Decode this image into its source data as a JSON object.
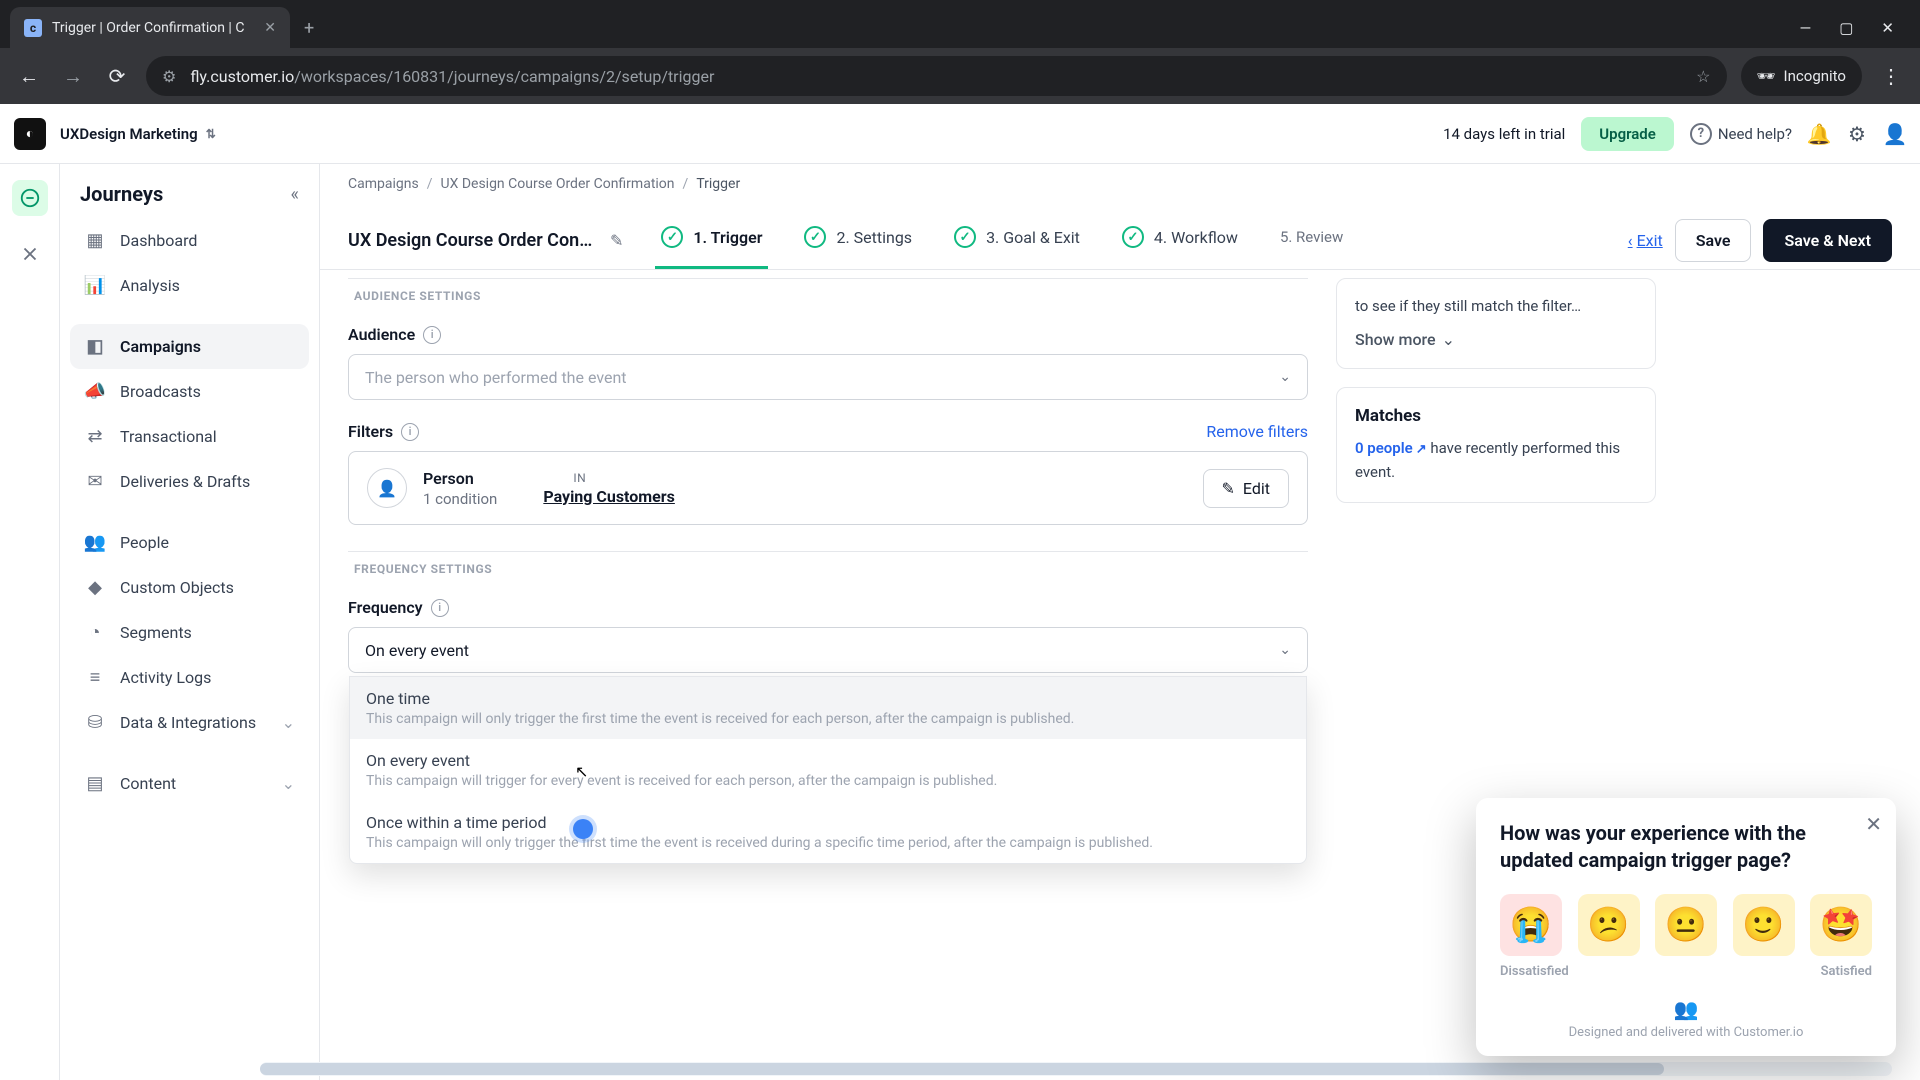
{
  "browser": {
    "tab_title": "Trigger | Order Confirmation | C",
    "url_host": "fly.customer.io",
    "url_path": "/workspaces/160831/journeys/campaigns/2/setup/trigger",
    "incognito": "Incognito"
  },
  "topbar": {
    "workspace": "UXDesign Marketing",
    "trial": "14 days left in trial",
    "upgrade": "Upgrade",
    "help": "Need help?"
  },
  "sidebar": {
    "title": "Journeys",
    "items": [
      {
        "label": "Dashboard"
      },
      {
        "label": "Analysis"
      },
      {
        "label": "Campaigns"
      },
      {
        "label": "Broadcasts"
      },
      {
        "label": "Transactional"
      },
      {
        "label": "Deliveries & Drafts"
      },
      {
        "label": "People"
      },
      {
        "label": "Custom Objects"
      },
      {
        "label": "Segments"
      },
      {
        "label": "Activity Logs"
      },
      {
        "label": "Data & Integrations"
      },
      {
        "label": "Content"
      }
    ]
  },
  "crumbs": {
    "a": "Campaigns",
    "b": "UX Design Course Order Confirmation",
    "c": "Trigger"
  },
  "header": {
    "campaign_name": "UX Design Course Order Confi…",
    "exit": "Exit",
    "save": "Save",
    "save_next": "Save & Next",
    "steps": [
      {
        "label": "1. Trigger"
      },
      {
        "label": "2. Settings"
      },
      {
        "label": "3. Goal & Exit"
      },
      {
        "label": "4. Workflow"
      },
      {
        "label": "5. Review"
      }
    ]
  },
  "form": {
    "audience_section": "AUDIENCE SETTINGS",
    "audience_label": "Audience",
    "audience_placeholder": "The person who performed the event",
    "filters_label": "Filters",
    "remove_filters": "Remove filters",
    "filter_title": "Person",
    "filter_sub": "1 condition",
    "filter_in": "IN",
    "filter_segment": "Paying Customers",
    "edit": "Edit",
    "freq_section": "FREQUENCY SETTINGS",
    "freq_label": "Frequency",
    "freq_value": "On every event",
    "freq_options": [
      {
        "title": "One time",
        "desc": "This campaign will only trigger the first time the event is received for each person, after the campaign is published."
      },
      {
        "title": "On every event",
        "desc": "This campaign will trigger for every event is received for each person, after the campaign is published."
      },
      {
        "title": "Once within a time period",
        "desc": "This campaign will only trigger the first time the event is received during a specific time period, after the campaign is published."
      }
    ]
  },
  "sidepanel": {
    "info_text": "to see if they still match the filter…",
    "show_more": "Show more",
    "matches_title": "Matches",
    "matches_count": "0 people",
    "matches_tail": " have recently performed this event."
  },
  "feedback": {
    "question": "How was your experience with the updated campaign trigger page?",
    "low": "Dissatisfied",
    "high": "Satisfied",
    "brand": "Designed and delivered with Customer.io",
    "faces": [
      "😭",
      "😕",
      "😐",
      "🙂",
      "🤩"
    ]
  }
}
